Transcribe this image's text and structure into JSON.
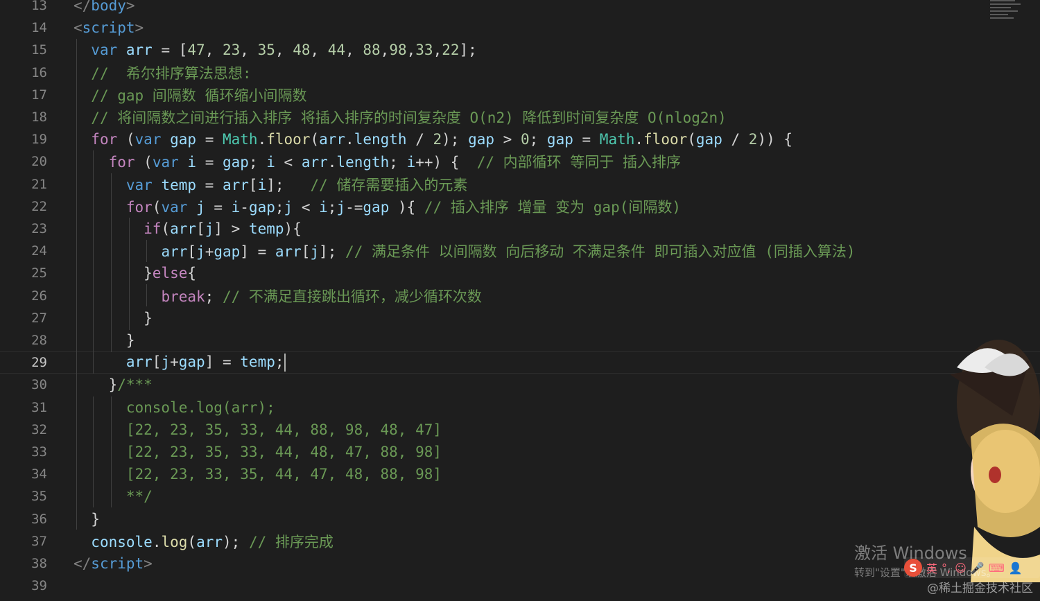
{
  "editor": {
    "lines": [
      {
        "n": "13",
        "parts": [
          {
            "t": "</",
            "c": "punct"
          },
          {
            "t": "body",
            "c": "tag"
          },
          {
            "t": ">",
            "c": "punct"
          }
        ]
      },
      {
        "n": "14",
        "parts": [
          {
            "t": "<",
            "c": "punct"
          },
          {
            "t": "script",
            "c": "tag"
          },
          {
            "t": ">",
            "c": "punct"
          }
        ]
      },
      {
        "n": "15",
        "parts": [
          {
            "t": "  "
          },
          {
            "t": "var",
            "c": "kw"
          },
          {
            "t": " "
          },
          {
            "t": "arr",
            "c": "var"
          },
          {
            "t": " = ["
          },
          {
            "t": "47",
            "c": "num"
          },
          {
            "t": ", "
          },
          {
            "t": "23",
            "c": "num"
          },
          {
            "t": ", "
          },
          {
            "t": "35",
            "c": "num"
          },
          {
            "t": ", "
          },
          {
            "t": "48",
            "c": "num"
          },
          {
            "t": ", "
          },
          {
            "t": "44",
            "c": "num"
          },
          {
            "t": ", "
          },
          {
            "t": "88",
            "c": "num"
          },
          {
            "t": ","
          },
          {
            "t": "98",
            "c": "num"
          },
          {
            "t": ","
          },
          {
            "t": "33",
            "c": "num"
          },
          {
            "t": ","
          },
          {
            "t": "22",
            "c": "num"
          },
          {
            "t": "];"
          }
        ]
      },
      {
        "n": "16",
        "parts": [
          {
            "t": "  "
          },
          {
            "t": "//  希尔排序算法思想:",
            "c": "cmt"
          }
        ]
      },
      {
        "n": "17",
        "parts": [
          {
            "t": "  "
          },
          {
            "t": "// gap 间隔数 循环缩小间隔数",
            "c": "cmt"
          }
        ]
      },
      {
        "n": "18",
        "parts": [
          {
            "t": "  "
          },
          {
            "t": "// 将间隔数之间进行插入排序 将插入排序的时间复杂度 O(n2) 降低到时间复杂度 O(nlog2n)",
            "c": "cmt"
          }
        ]
      },
      {
        "n": "19",
        "parts": [
          {
            "t": "  "
          },
          {
            "t": "for",
            "c": "ctl"
          },
          {
            "t": " ("
          },
          {
            "t": "var",
            "c": "kw"
          },
          {
            "t": " "
          },
          {
            "t": "gap",
            "c": "var"
          },
          {
            "t": " = "
          },
          {
            "t": "Math",
            "c": "cls"
          },
          {
            "t": "."
          },
          {
            "t": "floor",
            "c": "fn"
          },
          {
            "t": "("
          },
          {
            "t": "arr",
            "c": "var"
          },
          {
            "t": "."
          },
          {
            "t": "length",
            "c": "var"
          },
          {
            "t": " / "
          },
          {
            "t": "2",
            "c": "num"
          },
          {
            "t": "); "
          },
          {
            "t": "gap",
            "c": "var"
          },
          {
            "t": " > "
          },
          {
            "t": "0",
            "c": "num"
          },
          {
            "t": "; "
          },
          {
            "t": "gap",
            "c": "var"
          },
          {
            "t": " = "
          },
          {
            "t": "Math",
            "c": "cls"
          },
          {
            "t": "."
          },
          {
            "t": "floor",
            "c": "fn"
          },
          {
            "t": "("
          },
          {
            "t": "gap",
            "c": "var"
          },
          {
            "t": " / "
          },
          {
            "t": "2",
            "c": "num"
          },
          {
            "t": ")) {"
          }
        ]
      },
      {
        "n": "20",
        "parts": [
          {
            "t": "    "
          },
          {
            "t": "for",
            "c": "ctl"
          },
          {
            "t": " ("
          },
          {
            "t": "var",
            "c": "kw"
          },
          {
            "t": " "
          },
          {
            "t": "i",
            "c": "var"
          },
          {
            "t": " = "
          },
          {
            "t": "gap",
            "c": "var"
          },
          {
            "t": "; "
          },
          {
            "t": "i",
            "c": "var"
          },
          {
            "t": " < "
          },
          {
            "t": "arr",
            "c": "var"
          },
          {
            "t": "."
          },
          {
            "t": "length",
            "c": "var"
          },
          {
            "t": "; "
          },
          {
            "t": "i",
            "c": "var"
          },
          {
            "t": "++) {  "
          },
          {
            "t": "// 内部循环 等同于 插入排序",
            "c": "cmt"
          }
        ]
      },
      {
        "n": "21",
        "parts": [
          {
            "t": "      "
          },
          {
            "t": "var",
            "c": "kw"
          },
          {
            "t": " "
          },
          {
            "t": "temp",
            "c": "var"
          },
          {
            "t": " = "
          },
          {
            "t": "arr",
            "c": "var"
          },
          {
            "t": "["
          },
          {
            "t": "i",
            "c": "var"
          },
          {
            "t": "];   "
          },
          {
            "t": "// 储存需要插入的元素",
            "c": "cmt"
          }
        ]
      },
      {
        "n": "22",
        "parts": [
          {
            "t": "      "
          },
          {
            "t": "for",
            "c": "ctl"
          },
          {
            "t": "("
          },
          {
            "t": "var",
            "c": "kw"
          },
          {
            "t": " "
          },
          {
            "t": "j",
            "c": "var"
          },
          {
            "t": " = "
          },
          {
            "t": "i",
            "c": "var"
          },
          {
            "t": "-"
          },
          {
            "t": "gap",
            "c": "var"
          },
          {
            "t": ";"
          },
          {
            "t": "j",
            "c": "var"
          },
          {
            "t": " < "
          },
          {
            "t": "i",
            "c": "var"
          },
          {
            "t": ";"
          },
          {
            "t": "j",
            "c": "var"
          },
          {
            "t": "-="
          },
          {
            "t": "gap",
            "c": "var"
          },
          {
            "t": " ){ "
          },
          {
            "t": "// 插入排序 增量 变为 gap(间隔数)",
            "c": "cmt"
          }
        ]
      },
      {
        "n": "23",
        "parts": [
          {
            "t": "        "
          },
          {
            "t": "if",
            "c": "ctl"
          },
          {
            "t": "("
          },
          {
            "t": "arr",
            "c": "var"
          },
          {
            "t": "["
          },
          {
            "t": "j",
            "c": "var"
          },
          {
            "t": "] > "
          },
          {
            "t": "temp",
            "c": "var"
          },
          {
            "t": "){"
          }
        ]
      },
      {
        "n": "24",
        "parts": [
          {
            "t": "          "
          },
          {
            "t": "arr",
            "c": "var"
          },
          {
            "t": "["
          },
          {
            "t": "j",
            "c": "var"
          },
          {
            "t": "+"
          },
          {
            "t": "gap",
            "c": "var"
          },
          {
            "t": "] = "
          },
          {
            "t": "arr",
            "c": "var"
          },
          {
            "t": "["
          },
          {
            "t": "j",
            "c": "var"
          },
          {
            "t": "]; "
          },
          {
            "t": "// 满足条件 以间隔数 向后移动 不满足条件 即可插入对应值 (同插入算法)",
            "c": "cmt"
          }
        ]
      },
      {
        "n": "25",
        "parts": [
          {
            "t": "        }"
          },
          {
            "t": "else",
            "c": "ctl"
          },
          {
            "t": "{"
          }
        ]
      },
      {
        "n": "26",
        "parts": [
          {
            "t": "          "
          },
          {
            "t": "break",
            "c": "ctl"
          },
          {
            "t": "; "
          },
          {
            "t": "// 不满足直接跳出循环，减少循环次数",
            "c": "cmt"
          }
        ]
      },
      {
        "n": "27",
        "parts": [
          {
            "t": "        }"
          }
        ]
      },
      {
        "n": "28",
        "parts": [
          {
            "t": "      }"
          }
        ]
      },
      {
        "n": "29",
        "parts": [
          {
            "t": "      "
          },
          {
            "t": "arr",
            "c": "var"
          },
          {
            "t": "["
          },
          {
            "t": "j",
            "c": "var"
          },
          {
            "t": "+"
          },
          {
            "t": "gap",
            "c": "var"
          },
          {
            "t": "] = "
          },
          {
            "t": "temp",
            "c": "var"
          },
          {
            "t": ";"
          }
        ],
        "cursor": true
      },
      {
        "n": "30",
        "parts": [
          {
            "t": "    }"
          },
          {
            "t": "/***",
            "c": "cmt"
          }
        ]
      },
      {
        "n": "31",
        "parts": [
          {
            "t": "      "
          },
          {
            "t": "console.log(arr);",
            "c": "cmt"
          }
        ]
      },
      {
        "n": "32",
        "parts": [
          {
            "t": "      "
          },
          {
            "t": "[22, 23, 35, 33, 44, 88, 98, 48, 47]",
            "c": "cmt"
          }
        ]
      },
      {
        "n": "33",
        "parts": [
          {
            "t": "      "
          },
          {
            "t": "[22, 23, 35, 33, 44, 48, 47, 88, 98]",
            "c": "cmt"
          }
        ]
      },
      {
        "n": "34",
        "parts": [
          {
            "t": "      "
          },
          {
            "t": "[22, 23, 33, 35, 44, 47, 48, 88, 98]",
            "c": "cmt"
          }
        ]
      },
      {
        "n": "35",
        "parts": [
          {
            "t": "      "
          },
          {
            "t": "**/",
            "c": "cmt"
          }
        ]
      },
      {
        "n": "36",
        "parts": [
          {
            "t": "  }"
          }
        ]
      },
      {
        "n": "37",
        "parts": [
          {
            "t": "  "
          },
          {
            "t": "console",
            "c": "var"
          },
          {
            "t": "."
          },
          {
            "t": "log",
            "c": "fn"
          },
          {
            "t": "("
          },
          {
            "t": "arr",
            "c": "var"
          },
          {
            "t": "); "
          },
          {
            "t": "// 排序完成",
            "c": "cmt"
          }
        ]
      },
      {
        "n": "38",
        "parts": [
          {
            "t": "</",
            "c": "punct"
          },
          {
            "t": "script",
            "c": "tag"
          },
          {
            "t": ">",
            "c": "punct"
          }
        ]
      },
      {
        "n": "39",
        "parts": []
      }
    ],
    "current_line": "29"
  },
  "overlay": {
    "activation_title": "激活 Windows",
    "activation_sub": "转到\"设置\"以激活 Windows。",
    "ime_logo": "S",
    "ime_lang": "英",
    "ime_punct": "°,",
    "credit": "@稀土掘金技术社区"
  },
  "colors": {
    "background": "#1e1e1e",
    "keyword": "#569cd6",
    "control": "#c586c0",
    "variable": "#9cdcfe",
    "function": "#dcdcaa",
    "class": "#4ec9b0",
    "number": "#b5cea8",
    "comment": "#6a9955"
  }
}
